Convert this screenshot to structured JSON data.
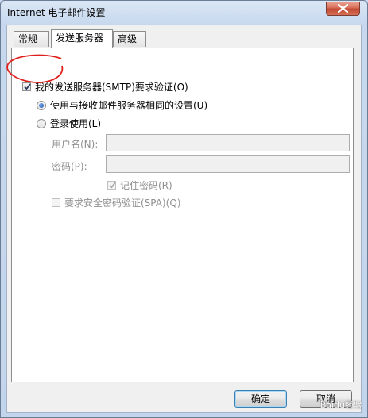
{
  "window": {
    "title": "Internet 电子邮件设置"
  },
  "tabs": [
    {
      "label": "常规",
      "active": false
    },
    {
      "label": "发送服务器",
      "active": true
    },
    {
      "label": "高级",
      "active": false
    }
  ],
  "outgoing": {
    "smtp_auth_label": "我的发送服务器(SMTP)要求验证(O)",
    "smtp_auth_checked": true,
    "same_settings_label": "使用与接收邮件服务器相同的设置(U)",
    "same_settings_selected": true,
    "logon_label": "登录使用(L)",
    "logon_selected": false,
    "username_label": "用户名(N):",
    "username_value": "",
    "password_label": "密码(P):",
    "password_value": "",
    "remember_password_label": "记住密码(R)",
    "remember_password_checked": true,
    "spa_label": "要求安全密码验证(SPA)(Q)",
    "spa_checked": false
  },
  "buttons": {
    "ok_label": "确定",
    "cancel_label": "取消"
  },
  "watermark": "Baidu经验",
  "colors": {
    "annotation_circle": "#e0201c",
    "selection_blue": "#1b4fa8"
  }
}
